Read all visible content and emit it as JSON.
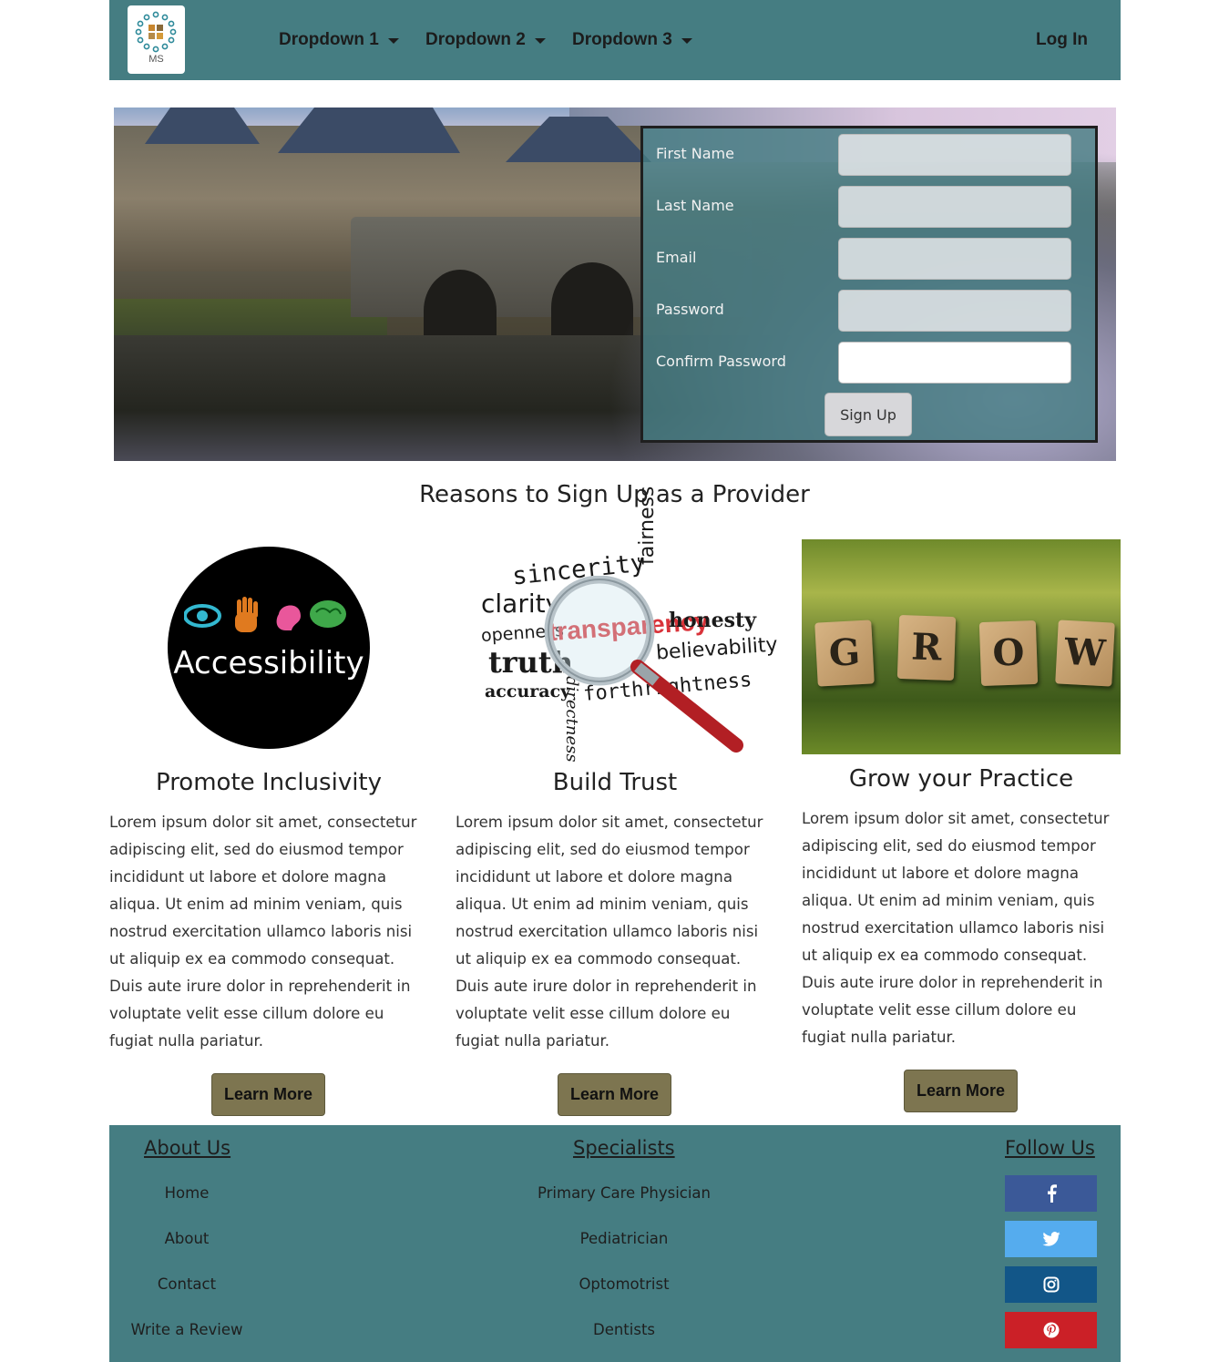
{
  "navbar": {
    "logo_text": "MS",
    "dropdowns": [
      "Dropdown 1",
      "Dropdown 2",
      "Dropdown 3"
    ],
    "login": "Log In",
    "background": "#457d82"
  },
  "signup_form": {
    "fields": [
      "First Name",
      "Last Name",
      "Email",
      "Password",
      "Confirm Password"
    ],
    "submit": "Sign Up"
  },
  "reasons": {
    "title": "Reasons to Sign Up as a Provider",
    "cards": [
      {
        "image_caption": "Accessibility",
        "title": "Promote Inclusivity",
        "body": "Lorem ipsum dolor sit amet, consectetur adipiscing elit, sed do eiusmod tempor incididunt ut labore et dolore magna aliqua. Ut enim ad minim veniam, quis nostrud exercitation ullamco laboris nisi ut aliquip ex ea commodo consequat. Duis aute irure dolor in reprehenderit in voluptate velit esse cillum dolore eu fugiat nulla pariatur.",
        "button": "Learn More"
      },
      {
        "image_words": [
          "sincerity",
          "fairness",
          "clarity",
          "openness",
          "transparency",
          "honesty",
          "truth",
          "believability",
          "accuracy",
          "directness",
          "forthrightness"
        ],
        "title": "Build Trust",
        "body": "Lorem ipsum dolor sit amet, consectetur adipiscing elit, sed do eiusmod tempor incididunt ut labore et dolore magna aliqua. Ut enim ad minim veniam, quis nostrud exercitation ullamco laboris nisi ut aliquip ex ea commodo consequat. Duis aute irure dolor in reprehenderit in voluptate velit esse cillum dolore eu fugiat nulla pariatur.",
        "button": "Learn More"
      },
      {
        "image_tiles": [
          "G",
          "R",
          "O",
          "W"
        ],
        "title": "Grow your Practice",
        "body": "Lorem ipsum dolor sit amet, consectetur adipiscing elit, sed do eiusmod tempor incididunt ut labore et dolore magna aliqua. Ut enim ad minim veniam, quis nostrud exercitation ullamco laboris nisi ut aliquip ex ea commodo consequat. Duis aute irure dolor in reprehenderit in voluptate velit esse cillum dolore eu fugiat nulla pariatur.",
        "button": "Learn More"
      }
    ],
    "button_color": "#7d7550"
  },
  "footer": {
    "about": {
      "heading": "About Us",
      "links": [
        "Home",
        "About",
        "Contact",
        "Write a Review"
      ]
    },
    "specialists": {
      "heading": "Specialists",
      "links": [
        "Primary Care Physician",
        "Pediatrician",
        "Optomotrist",
        "Dentists"
      ]
    },
    "follow": {
      "heading": "Follow Us",
      "networks": [
        {
          "icon": "facebook-icon",
          "color": "#3b5998"
        },
        {
          "icon": "twitter-icon",
          "color": "#55acee"
        },
        {
          "icon": "instagram-icon",
          "color": "#125688"
        },
        {
          "icon": "pinterest-icon",
          "color": "#cb2027"
        }
      ]
    }
  }
}
